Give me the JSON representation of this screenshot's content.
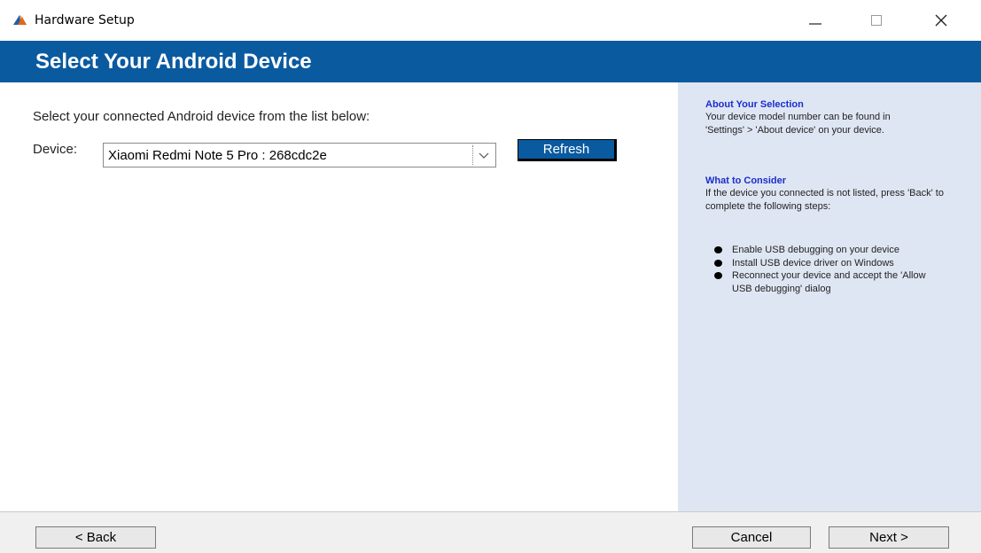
{
  "window": {
    "title": "Hardware Setup",
    "app_icon": "matlab-logo-icon",
    "controls": [
      "minimize-icon",
      "maximize-icon",
      "close-icon"
    ]
  },
  "header": {
    "title": "Select Your Android Device",
    "background": "#0a5aa0"
  },
  "main": {
    "instruction": "Select your connected Android device from the list below:",
    "device_label": "Device:",
    "device_select": {
      "selected": "Xiaomi Redmi Note 5 Pro : 268cdc2e"
    },
    "refresh_label": "Refresh"
  },
  "sidebar": {
    "background": "#dfe6f3",
    "about_heading": "About Your Selection",
    "about_text": "Your device model number can be found in 'Settings' > 'About device' on your device.",
    "consider_heading": "What to Consider",
    "consider_text": "If the device you connected is not listed, press 'Back' to complete the following steps:",
    "steps": [
      "Enable USB debugging on your device",
      "Install USB device driver on Windows",
      "Reconnect your device and accept the 'Allow USB debugging' dialog"
    ]
  },
  "footer": {
    "back_label": "< Back",
    "cancel_label": "Cancel",
    "next_label": "Next >"
  }
}
